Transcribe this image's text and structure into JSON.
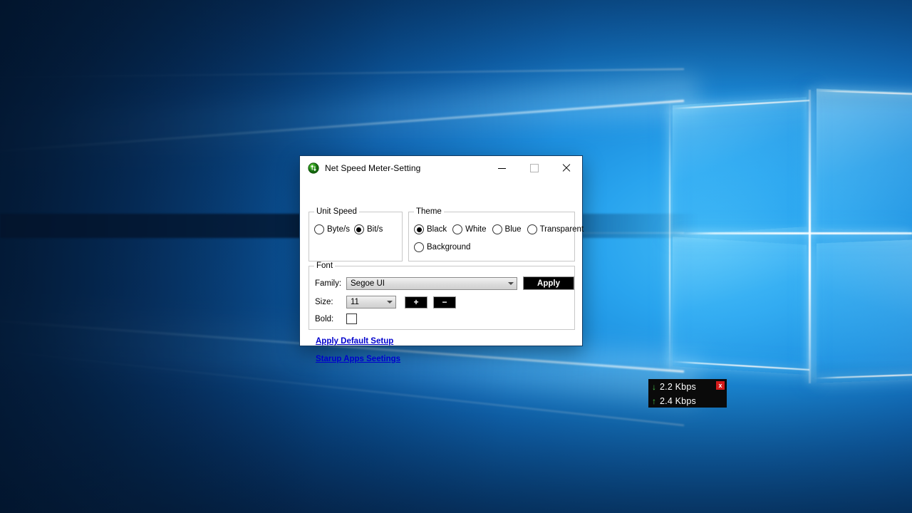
{
  "desktop": {
    "wallpaper_name": "windows-10-hero-wallpaper",
    "colors": {
      "deep_navy": "#05264b",
      "mid_blue": "#116fc2",
      "bright_cyan": "#3fb8f5",
      "band_dark": "#0a2647"
    }
  },
  "window": {
    "title": "Net Speed Meter-Setting",
    "icon_name": "net-speed-meter-icon",
    "controls": {
      "minimize": "minimize",
      "maximize": "maximize",
      "close": "close"
    },
    "unit_speed": {
      "legend": "Unit Speed",
      "options": [
        {
          "label": "Byte/s",
          "selected": false
        },
        {
          "label": "Bit/s",
          "selected": true
        }
      ]
    },
    "theme": {
      "legend": "Theme",
      "options": [
        {
          "label": "Black",
          "selected": true
        },
        {
          "label": "White",
          "selected": false
        },
        {
          "label": "Blue",
          "selected": false
        },
        {
          "label": "Transparent",
          "selected": false
        },
        {
          "label": "Background",
          "selected": false
        }
      ]
    },
    "font": {
      "legend": "Font",
      "family_label": "Family:",
      "family_value": "Segoe UI",
      "size_label": "Size:",
      "size_value": "11",
      "bold_label": "Bold:",
      "bold_checked": false,
      "apply_label": "Apply",
      "increase_label": "+",
      "decrease_label": "−"
    },
    "links": [
      {
        "label": "Apply Default Setup"
      },
      {
        "label": "Starup Apps Seetings"
      }
    ]
  },
  "widget": {
    "download": {
      "arrow": "↓",
      "value": "2.2 Kbps"
    },
    "upload": {
      "arrow": "↑",
      "value": "2.4 Kbps"
    },
    "close_label": "x",
    "accent_green": "#49c74a",
    "close_red": "#d41b1b"
  }
}
